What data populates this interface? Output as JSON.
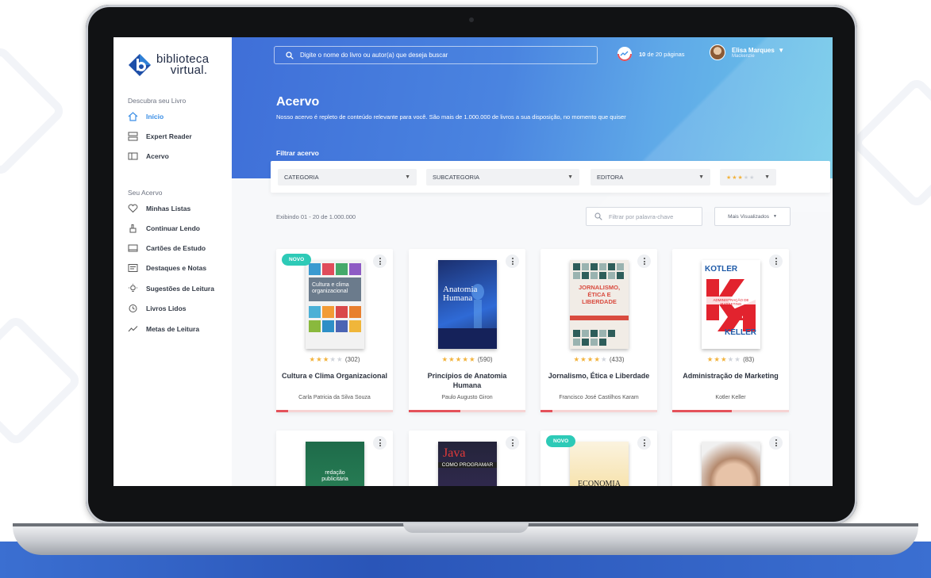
{
  "brand": {
    "line1": "biblioteca",
    "line2": "virtual."
  },
  "sidebar": {
    "section1": "Descubra seu Livro",
    "section2": "Seu Acervo",
    "items": [
      {
        "label": "Início",
        "icon": "home-icon",
        "active": true
      },
      {
        "label": "Expert Reader",
        "icon": "stack-icon"
      },
      {
        "label": "Acervo",
        "icon": "book-icon"
      },
      {
        "label": "Minhas Listas",
        "icon": "heart-icon"
      },
      {
        "label": "Continuar Lendo",
        "icon": "hand-icon"
      },
      {
        "label": "Cartões de Estudo",
        "icon": "card-icon"
      },
      {
        "label": "Destaques e Notas",
        "icon": "notes-icon"
      },
      {
        "label": "Sugestões de Leitura",
        "icon": "bulb-icon"
      },
      {
        "label": "Livros Lidos",
        "icon": "history-icon"
      },
      {
        "label": "Metas de Leitura",
        "icon": "trend-icon"
      }
    ]
  },
  "header": {
    "search_placeholder": "Digite o nome do livro ou autor(a) que deseja buscar",
    "progress_bold": "10",
    "progress_rest": " de 20 páginas",
    "user_name": "Elisa Marques",
    "user_org": "Mackenzie"
  },
  "hero": {
    "title": "Acervo",
    "subtitle": "Nosso acervo é repleto de conteúdo relevante para você. São mais de 1.000.000 de livros a sua disposição, no momento que quiser",
    "filter_title": "Filtrar acervo"
  },
  "filters": {
    "categoria": "CATEGORIA",
    "subcategoria": "SUBCATEGORIA",
    "editora": "EDITORA",
    "rating": 3
  },
  "results": {
    "count": "Exibindo 01 - 20 de 1.000.000",
    "keyword_placeholder": "Filtrar por palavra-chave",
    "sort": "Mais Visualizados"
  },
  "books": [
    {
      "badge": "NOVO",
      "rating": 3,
      "reviews": "(302)",
      "title": "Cultura e Clima Organizacional",
      "author": "Carla Patricia da Silva Souza",
      "progress": 0.1
    },
    {
      "badge": "",
      "rating": 5,
      "reviews": "(590)",
      "title": "Princípios de Anatomia Humana",
      "author": "Paulo Augusto Giron",
      "progress": 0.44
    },
    {
      "badge": "",
      "rating": 4,
      "reviews": "(433)",
      "title": "Jornalismo, Ética e Liberdade",
      "author": "Francisco José Castilhos Karam",
      "progress": 0.1
    },
    {
      "badge": "",
      "rating": 3,
      "reviews": "(83)",
      "title": "Administração de Marketing",
      "author": "Kotler Keller",
      "progress": 0.51
    }
  ],
  "books_row2": [
    {
      "badge": ""
    },
    {
      "badge": ""
    },
    {
      "badge": "NOVO"
    },
    {
      "badge": ""
    }
  ],
  "covers": {
    "c1_title": "Cultura e clima organizacional",
    "c2_title": "Anatomia Humana",
    "c3_title": "JORNALISMO, ÉTICA E LIBERDADE",
    "c4_top": "KOTLER",
    "c4_bottom": "KELLER",
    "c4_band": "ADMINISTRAÇÃO DE MARKETING",
    "c5_title": "redação publicitária",
    "c6_title": "Java",
    "c6_sub": "COMO PROGRAMAR",
    "c7_title": "ECONOMIA"
  },
  "colors": {
    "accent": "#3a8ee6",
    "badge": "#2dcab7",
    "star": "#f2b33d",
    "progress": "#e4525a"
  }
}
